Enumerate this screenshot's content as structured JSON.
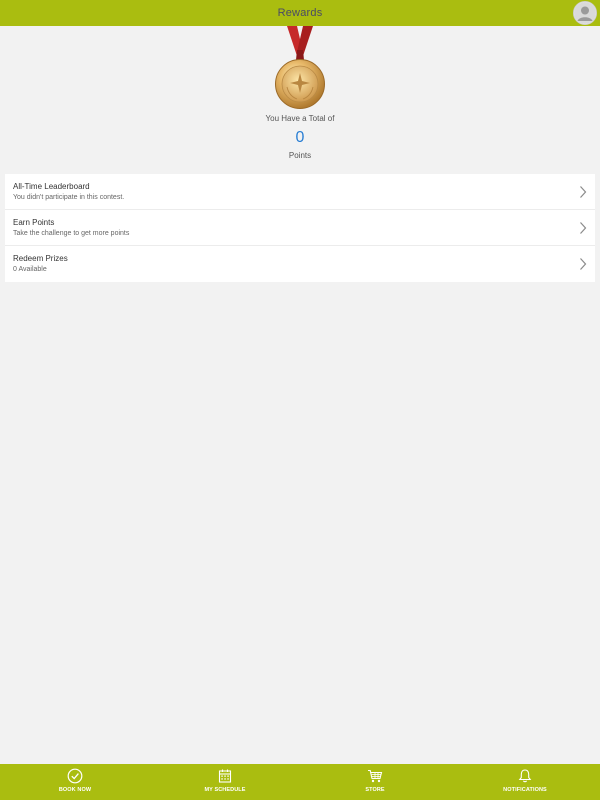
{
  "header": {
    "title": "Rewards",
    "background": "#aabd10"
  },
  "rewards": {
    "total_label": "You Have a Total of",
    "points_value": "0",
    "points_label": "Points",
    "points_color": "#2a7fd4",
    "medal_icon": "gold-medal-icon"
  },
  "menu": {
    "items": [
      {
        "title": "All-Time Leaderboard",
        "subtitle": "You didn't participate in this contest."
      },
      {
        "title": "Earn Points",
        "subtitle": "Take the challenge to get more points"
      },
      {
        "title": "Redeem Prizes",
        "subtitle": "0 Available"
      }
    ]
  },
  "bottom_nav": {
    "items": [
      {
        "label": "BOOK NOW",
        "icon": "check-circle-icon"
      },
      {
        "label": "MY SCHEDULE",
        "icon": "calendar-icon"
      },
      {
        "label": "STORE",
        "icon": "cart-icon"
      },
      {
        "label": "NOTIFICATIONS",
        "icon": "bell-icon"
      }
    ]
  }
}
